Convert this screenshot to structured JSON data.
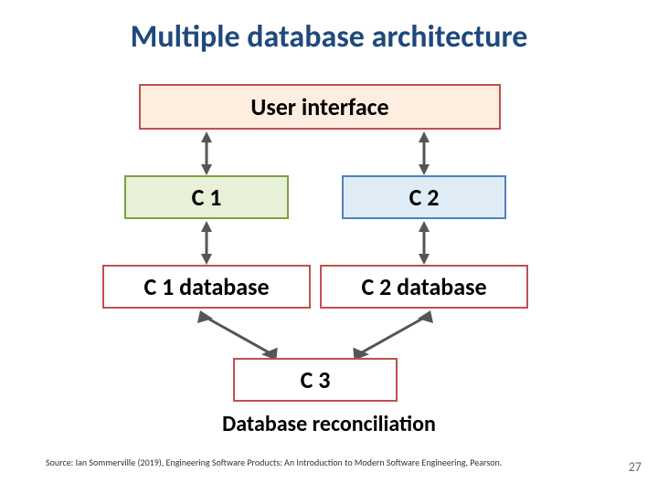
{
  "title": "Multiple database architecture",
  "boxes": {
    "ui": "User interface",
    "c1": "C 1",
    "c2": "C 2",
    "c1db": "C 1 database",
    "c2db": "C 2 database",
    "c3": "C 3"
  },
  "caption": "Database reconciliation",
  "source": "Source: Ian Sommerville (2019), Engineering Software Products:  An Introduction to Modern Software Engineering, Pearson.",
  "page": "27",
  "colors": {
    "title": "#1f497d",
    "ui_fill": "#fdeee0",
    "ui_border": "#c0504d",
    "c1_fill": "#e8f0d9",
    "c1_border": "#7aa23f",
    "c2_fill": "#e0ecf5",
    "c2_border": "#4f81bd",
    "db_fill": "#ffffff",
    "db_border": "#c0504d",
    "arrow": "#555555"
  }
}
